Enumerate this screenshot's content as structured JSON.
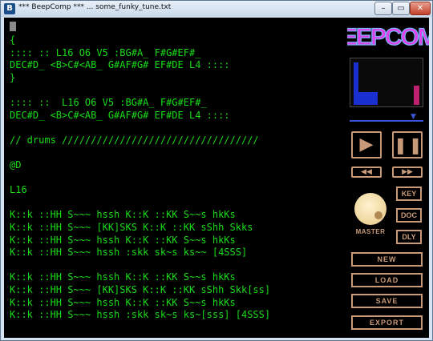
{
  "window": {
    "title": "*** BeepComp *** ... some_funky_tune.txt",
    "icon_letter": "B",
    "buttons": {
      "minimize": "–",
      "maximize": "▭",
      "close": "✕"
    }
  },
  "editor": {
    "lines": [
      "{",
      ":::: :: L16 O6 V5 :BG#A_ F#G#EF#_",
      "DEC#D_ <B>C#<AB_ G#AF#G# EF#DE L4 ::::",
      "}",
      "",
      ":::: ::  L16 O6 V5 :BG#A_ F#G#EF#_",
      "DEC#D_ <B>C#<AB_ G#AF#G# EF#DE L4 ::::",
      "",
      "// drums //////////////////////////////////",
      "",
      "@D",
      "",
      "L16",
      "",
      "K::k ::HH S~~~ hssh K::K ::KK S~~s hkKs",
      "K::k ::HH S~~~ [KK]SKS K::K ::KK sShh Skks",
      "K::k ::HH S~~~ hssh K::K ::KK S~~s hkKs",
      "K::k ::HH S~~~ hssh :skk sk~s ks~~ [4SSS]",
      "",
      "K::k ::HH S~~~ hssh K::K ::KK S~~s hkKs",
      "K::k ::HH S~~~ [KK]SKS K::K ::KK sShh Skk[ss]",
      "K::k ::HH S~~~ hssh K::K ::KK S~~s hkKs",
      "K::k ::HH S~~~ hssh :skk sk~s ks~[sss] [4SSS]"
    ]
  },
  "sidebar": {
    "logo": "BEEPCOMP",
    "visualizer_levels": [
      0.92,
      0.28,
      0.28,
      0.28,
      0.28,
      0.42
    ],
    "visualizer_colors": [
      "#1a2fd0",
      "#1a2fd0",
      "#1a2fd0",
      "#1a2fd0",
      "#1a2fd0",
      "#c02070"
    ],
    "volume_level": 0.88,
    "transport": {
      "play": "▶",
      "pause": "❚❚",
      "rewind": "◀◀",
      "fast_forward": "▶▶"
    },
    "master_label": "MASTER",
    "side_buttons": {
      "key": "KEY",
      "doc": "DOC",
      "dly": "DLY"
    },
    "file_buttons": {
      "new": "NEW",
      "load": "LOAD",
      "save": "SAVE",
      "export": "EXPORT"
    }
  },
  "colors": {
    "code": "#19dc19",
    "accent": "#c89a78",
    "logo": "#e040e6"
  }
}
